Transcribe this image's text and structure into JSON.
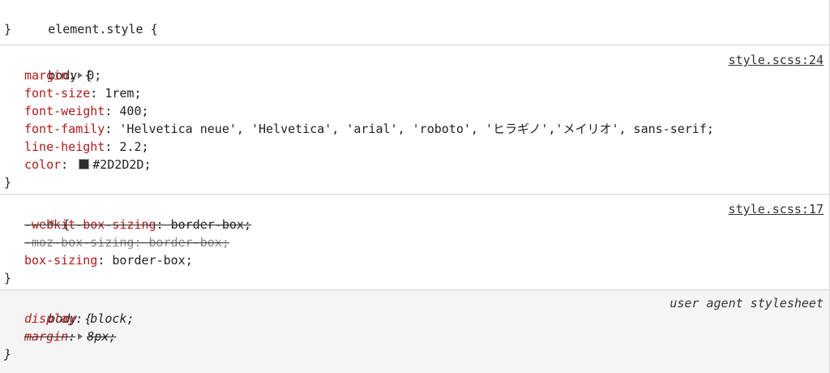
{
  "element_style": {
    "selector": "element.style",
    "open": "{",
    "close": "}"
  },
  "rule1": {
    "selector": "body",
    "open": "{",
    "close": "}",
    "source": "style.scss:24",
    "decls": [
      {
        "prop": "margin",
        "value": "0"
      },
      {
        "prop": "font-size",
        "value": "1rem"
      },
      {
        "prop": "font-weight",
        "value": "400"
      },
      {
        "prop": "font-family",
        "value": "'Helvetica neue', 'Helvetica', 'arial', 'roboto', 'ヒラギノ','メイリオ', sans-serif"
      },
      {
        "prop": "line-height",
        "value": "2.2"
      },
      {
        "prop": "color",
        "value": "#2D2D2D",
        "swatch_color": "#2D2D2D"
      }
    ]
  },
  "rule2": {
    "selector": "*",
    "open": "{",
    "close": "}",
    "source": "style.scss:17",
    "decls": [
      {
        "prop": "-webkit-box-sizing",
        "value": "border-box"
      },
      {
        "prop": "-moz-box-sizing",
        "value": "border-box"
      },
      {
        "prop": "box-sizing",
        "value": "border-box"
      }
    ]
  },
  "rule3": {
    "selector": "body",
    "open": "{",
    "close": "}",
    "source": "user agent stylesheet",
    "decls": [
      {
        "prop": "display",
        "value": "block"
      },
      {
        "prop": "margin",
        "value": "8px"
      }
    ]
  },
  "colors": {
    "property": "#b01a1a",
    "overridden": "#8a8a8a",
    "ua_background": "#f5f5f5"
  }
}
